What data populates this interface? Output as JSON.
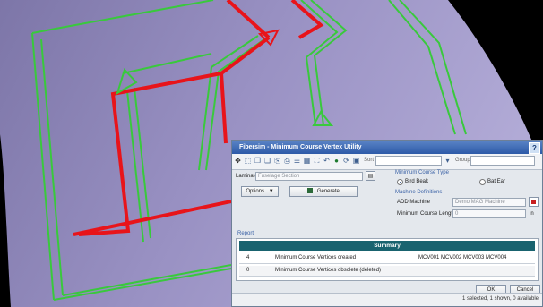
{
  "dialog": {
    "title": "Fibersim - Minimum Course Vertex Utility",
    "help_label": "?"
  },
  "toolbar": {
    "sort_label": "Sort",
    "group_label": "Group"
  },
  "laminate": {
    "label": "Laminate",
    "value": "Fuselage Section"
  },
  "options_button": {
    "label": "Options",
    "arrow": "▼"
  },
  "generate_button": {
    "label": "Generate"
  },
  "course_type": {
    "title": "Minimum Course Type",
    "options": [
      {
        "label": "Bird Beak",
        "selected": true
      },
      {
        "label": "Bat Ear",
        "selected": false
      }
    ]
  },
  "machine": {
    "title": "Machine Definitions",
    "add_machine_label": "ADD Machine",
    "add_machine_value": "Demo MAG Machine",
    "min_course_label": "Minimum Course Length",
    "min_course_value": "0",
    "unit": "in"
  },
  "report": {
    "title": "Report",
    "summary_title": "Summary",
    "rows": [
      {
        "count": "4",
        "description": "Minimum Course Vertices created",
        "ids": "MCV001 MCV002 MCV003 MCV004"
      },
      {
        "count": "0",
        "description": "Minimum Course Vertices obsolete (deleted)",
        "ids": ""
      }
    ]
  },
  "buttons": {
    "ok": "OK",
    "cancel": "Cancel"
  },
  "status": {
    "text": "1 selected, 1 shown, 0 available"
  },
  "colors": {
    "surface": "#8e86b8",
    "red_path": "#e8141a",
    "green_path": "#39c93c",
    "title_bar": "#2d5aa8",
    "summary_header": "#19636f"
  }
}
